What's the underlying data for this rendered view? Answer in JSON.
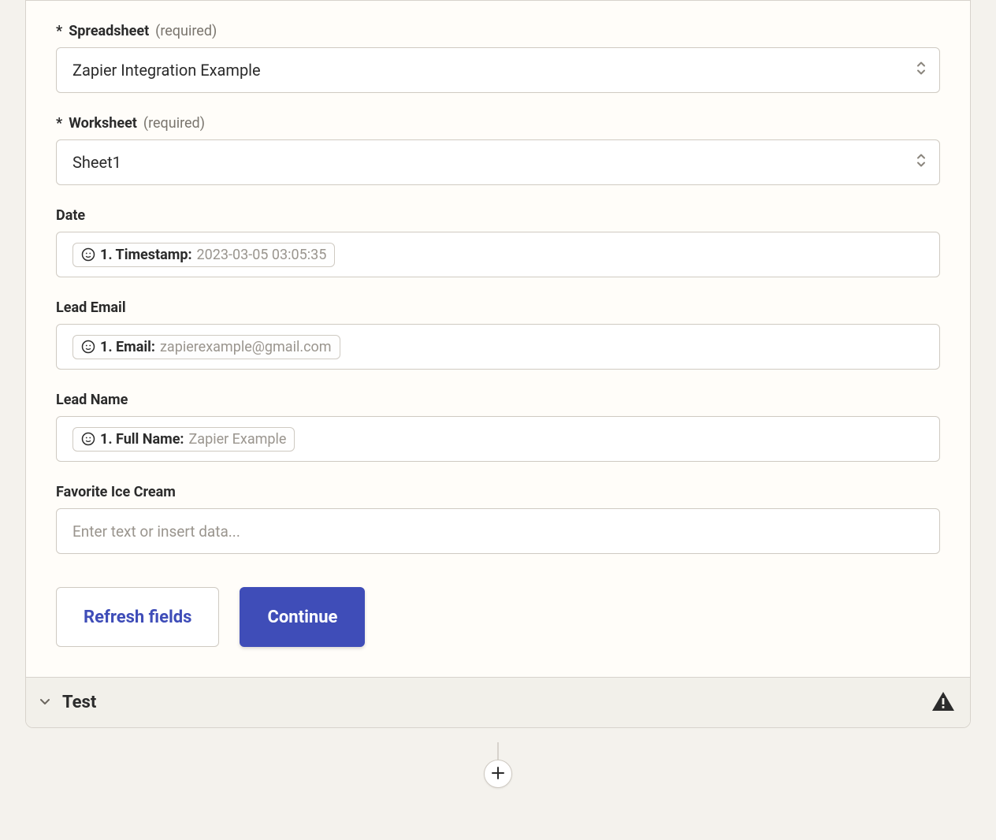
{
  "labels": {
    "required": "(required)"
  },
  "fields": {
    "spreadsheet": {
      "label": "Spreadsheet",
      "value": "Zapier Integration Example"
    },
    "worksheet": {
      "label": "Worksheet",
      "value": "Sheet1"
    },
    "date": {
      "label": "Date",
      "pill_label": "1. Timestamp:",
      "pill_value": "2023-03-05 03:05:35"
    },
    "lead_email": {
      "label": "Lead Email",
      "pill_label": "1. Email:",
      "pill_value": "zapierexample@gmail.com"
    },
    "lead_name": {
      "label": "Lead Name",
      "pill_label": "1. Full Name:",
      "pill_value": "Zapier Example"
    },
    "favorite_ice_cream": {
      "label": "Favorite Ice Cream",
      "placeholder": "Enter text or insert data..."
    }
  },
  "buttons": {
    "refresh": "Refresh fields",
    "continue": "Continue"
  },
  "test_section": {
    "title": "Test"
  }
}
